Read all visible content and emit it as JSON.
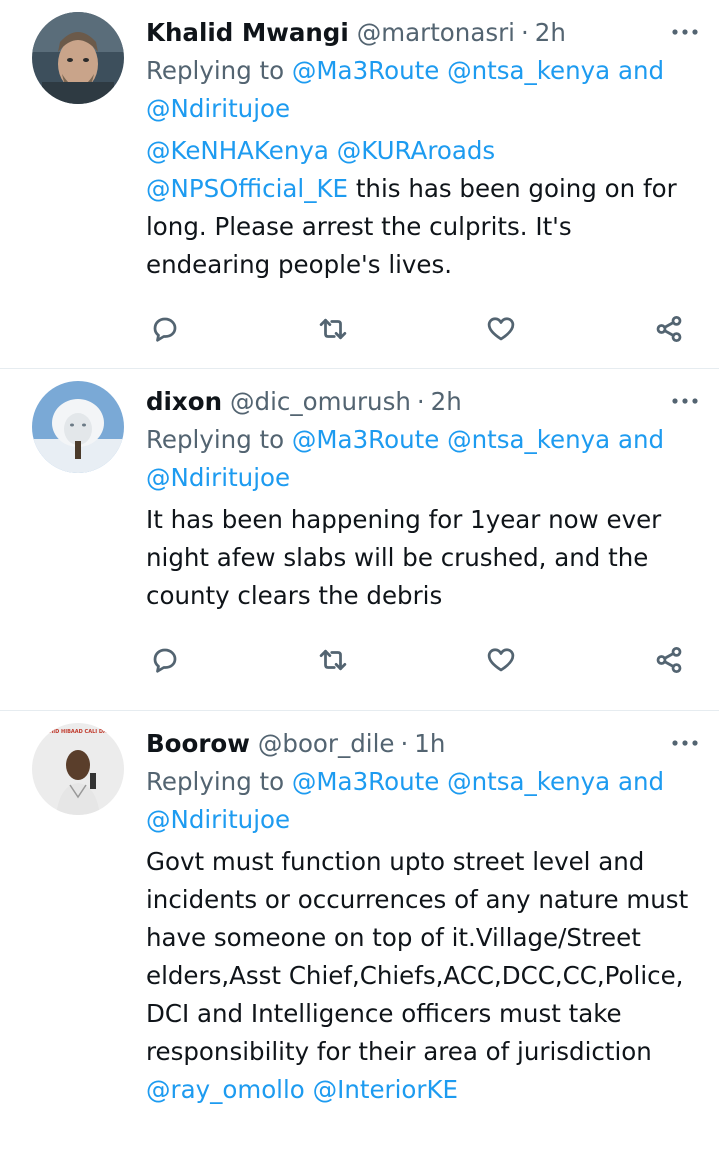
{
  "tweets": [
    {
      "name": "Khalid Mwangi",
      "handle": "@martonasri",
      "dot": "·",
      "time": "2h",
      "replying_prefix": "Replying to",
      "replying_mentions": [
        "@Ma3Route",
        "@ntsa_kenya"
      ],
      "replying_and": "and",
      "replying_last": "@Ndiritujoe",
      "body_mentions": [
        "@KeNHAKenya",
        "@KURAroads",
        "@NPSOfficial_KE"
      ],
      "body_text": "this has been going on for long. Please arrest the culprits. It's endearing people's lives."
    },
    {
      "name": "dixon",
      "handle": "@dic_omurush",
      "dot": "·",
      "time": "2h",
      "replying_prefix": "Replying to",
      "replying_mentions": [
        "@Ma3Route",
        "@ntsa_kenya"
      ],
      "replying_and": "and",
      "replying_last": "@Ndiritujoe",
      "body_text": "It has been happening for 1year now ever night afew slabs will be crushed, and the county clears the debris"
    },
    {
      "name": "Boorow",
      "handle": "@boor_dile",
      "dot": "·",
      "time": "1h",
      "replying_prefix": "Replying to",
      "replying_mentions": [
        "@Ma3Route",
        "@ntsa_kenya"
      ],
      "replying_and": "and",
      "replying_last": "@Ndiritujoe",
      "avatar_banner_text": "SHAHID HIBAAD CALI DASAN",
      "body_text": "Govt must function upto street level and incidents or occurrences of any nature must have someone on top of it.Village/Street elders,Asst Chief,Chiefs,ACC,DCC,CC,Police, DCI and Intelligence officers must take responsibility for their area of jurisdiction",
      "body_trailing_mentions": [
        "@ray_omollo",
        "@InteriorKE"
      ]
    }
  ],
  "icons": {
    "more": "more-horizontal-icon",
    "reply": "reply-icon",
    "retweet": "retweet-icon",
    "like": "like-heart-icon",
    "share": "share-icon"
  },
  "colors": {
    "mention": "#1d9bf0",
    "secondary_text": "#536471",
    "primary_text": "#0f1419",
    "divider": "#e6ecf0"
  }
}
